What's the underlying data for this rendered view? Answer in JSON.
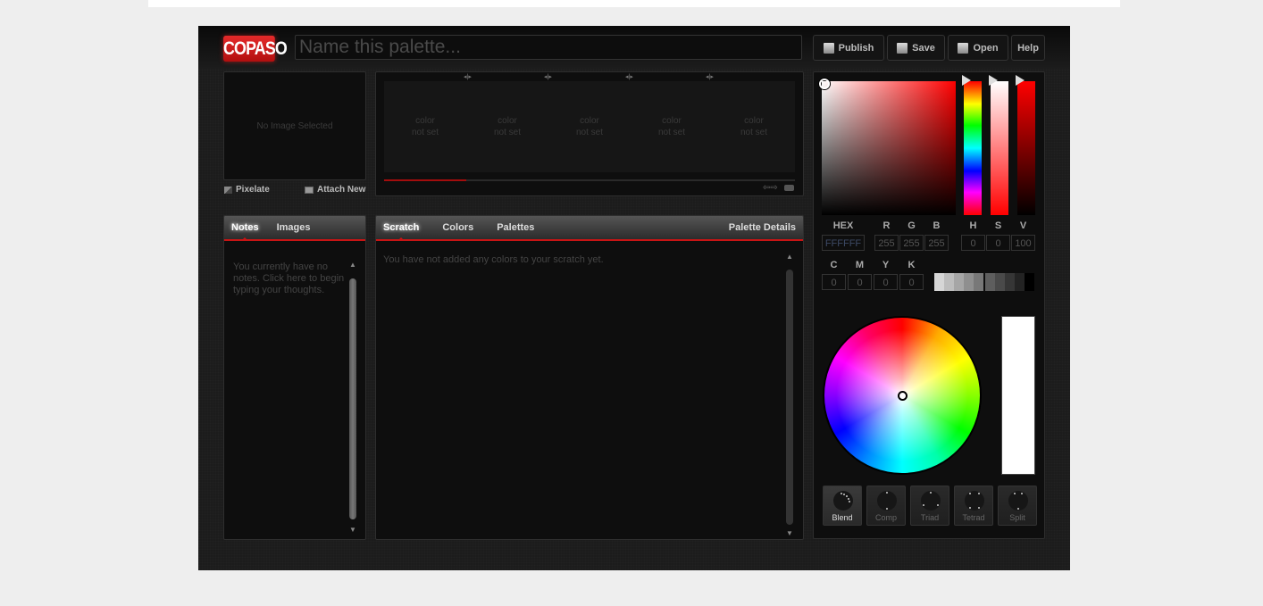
{
  "app": {
    "logo": "COPASO",
    "name_placeholder": "Name this palette...",
    "name_value": ""
  },
  "toolbar": {
    "publish": "Publish",
    "save": "Save",
    "open": "Open",
    "help": "Help"
  },
  "image_panel": {
    "message": "No Image Selected",
    "pixelate": "Pixelate",
    "attach_new": "Attach New"
  },
  "palette": {
    "swatches": [
      {
        "line1": "color",
        "line2": "not set"
      },
      {
        "line1": "color",
        "line2": "not set"
      },
      {
        "line1": "color",
        "line2": "not set"
      },
      {
        "line1": "color",
        "line2": "not set"
      },
      {
        "line1": "color",
        "line2": "not set"
      }
    ],
    "progress_fraction": 0.2
  },
  "notes_panel": {
    "tabs": [
      {
        "label": "Notes",
        "active": true
      },
      {
        "label": "Images",
        "active": false
      }
    ],
    "empty_text": "You currently have no notes. Click here to begin typing your thoughts."
  },
  "scratch_panel": {
    "tabs": [
      {
        "label": "Scratch",
        "active": true
      },
      {
        "label": "Colors",
        "active": false
      },
      {
        "label": "Palettes",
        "active": false
      }
    ],
    "right_tab": "Palette Details",
    "empty_text": "You have not added any colors to your scratch yet."
  },
  "picker": {
    "labels": {
      "hex": "HEX",
      "r": "R",
      "g": "G",
      "b": "B",
      "h": "H",
      "s": "S",
      "v": "V",
      "c": "C",
      "m": "M",
      "y": "Y",
      "k": "K"
    },
    "values": {
      "hex": "FFFFFF",
      "r": "255",
      "g": "255",
      "b": "255",
      "h": "0",
      "s": "0",
      "v": "100",
      "c": "0",
      "m": "0",
      "y": "0",
      "k": "0"
    },
    "gray_steps": [
      "#d6d6d6",
      "#bdbdbd",
      "#a6a6a6",
      "#8f8f8f",
      "#787878",
      "#5e5e5e",
      "#4a4a4a",
      "#363636",
      "#232323",
      "#000000"
    ],
    "preview_color": "#ffffff",
    "harmonies": [
      "Blend",
      "Comp",
      "Triad",
      "Tetrad",
      "Split"
    ],
    "active_harmony": "Blend"
  }
}
